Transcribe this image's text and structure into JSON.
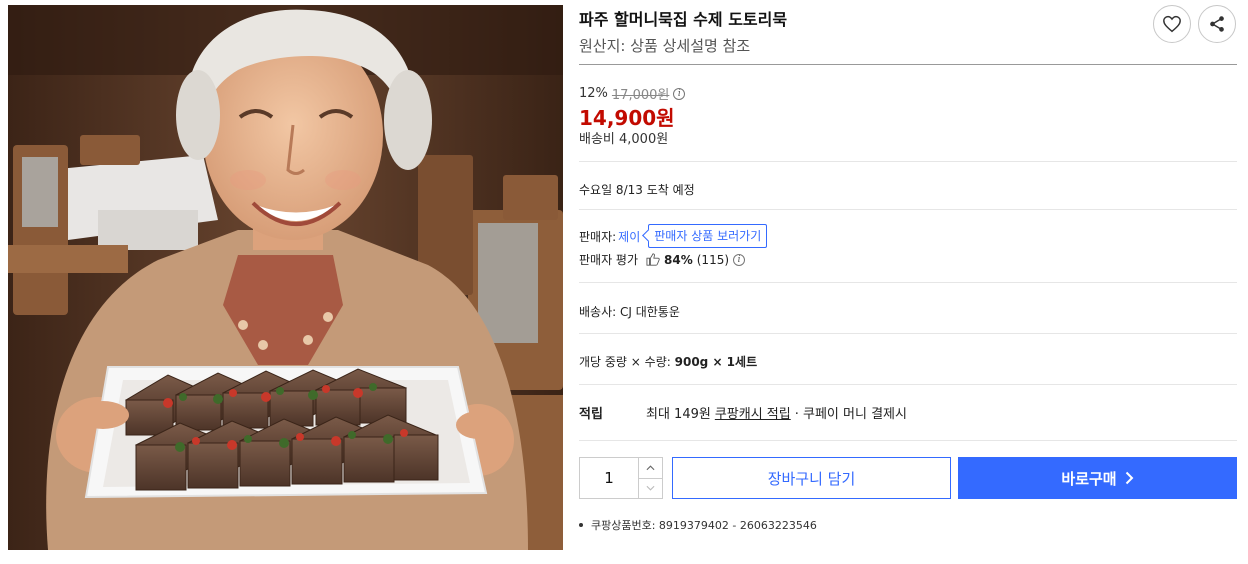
{
  "product": {
    "title": "파주 할머니묵집 수제 도토리묵",
    "origin": "원산지: 상품 상세설명 참조",
    "image_alt": "도토리묵 접시를 든 할머니"
  },
  "actions": {
    "wishlist_icon": "heart-icon",
    "share_icon": "share-icon"
  },
  "price": {
    "discount_rate": "12%",
    "original_price": "17,000원",
    "sale_price": "14,900원",
    "shipping_fee": "배송비 4,000원"
  },
  "delivery": {
    "arrival": "수요일 8/13 도착 예정",
    "carrier": "배송사:  CJ 대한통운"
  },
  "seller": {
    "label": "판매자:",
    "name": "제이",
    "view_products": "판매자 상품 보러가기",
    "rating_label": "판매자 평가",
    "rating_percent": "84%",
    "rating_count": "(115)"
  },
  "spec": {
    "weight_qty": "개당 중량 × 수량:",
    "weight_qty_value": "900g × 1세트"
  },
  "cashback": {
    "label": "적립",
    "prefix": "최대 149원",
    "link": "쿠팡캐시 적립",
    "suffix": "· 쿠페이 머니 결제시"
  },
  "purchase": {
    "quantity": "1",
    "add_to_cart": "장바구니 담기",
    "buy_now": "바로구매"
  },
  "product_number": "쿠팡상품번호: 8919379402 - 26063223546",
  "colors": {
    "accent": "#346aff",
    "sale_red": "#c20a00"
  }
}
